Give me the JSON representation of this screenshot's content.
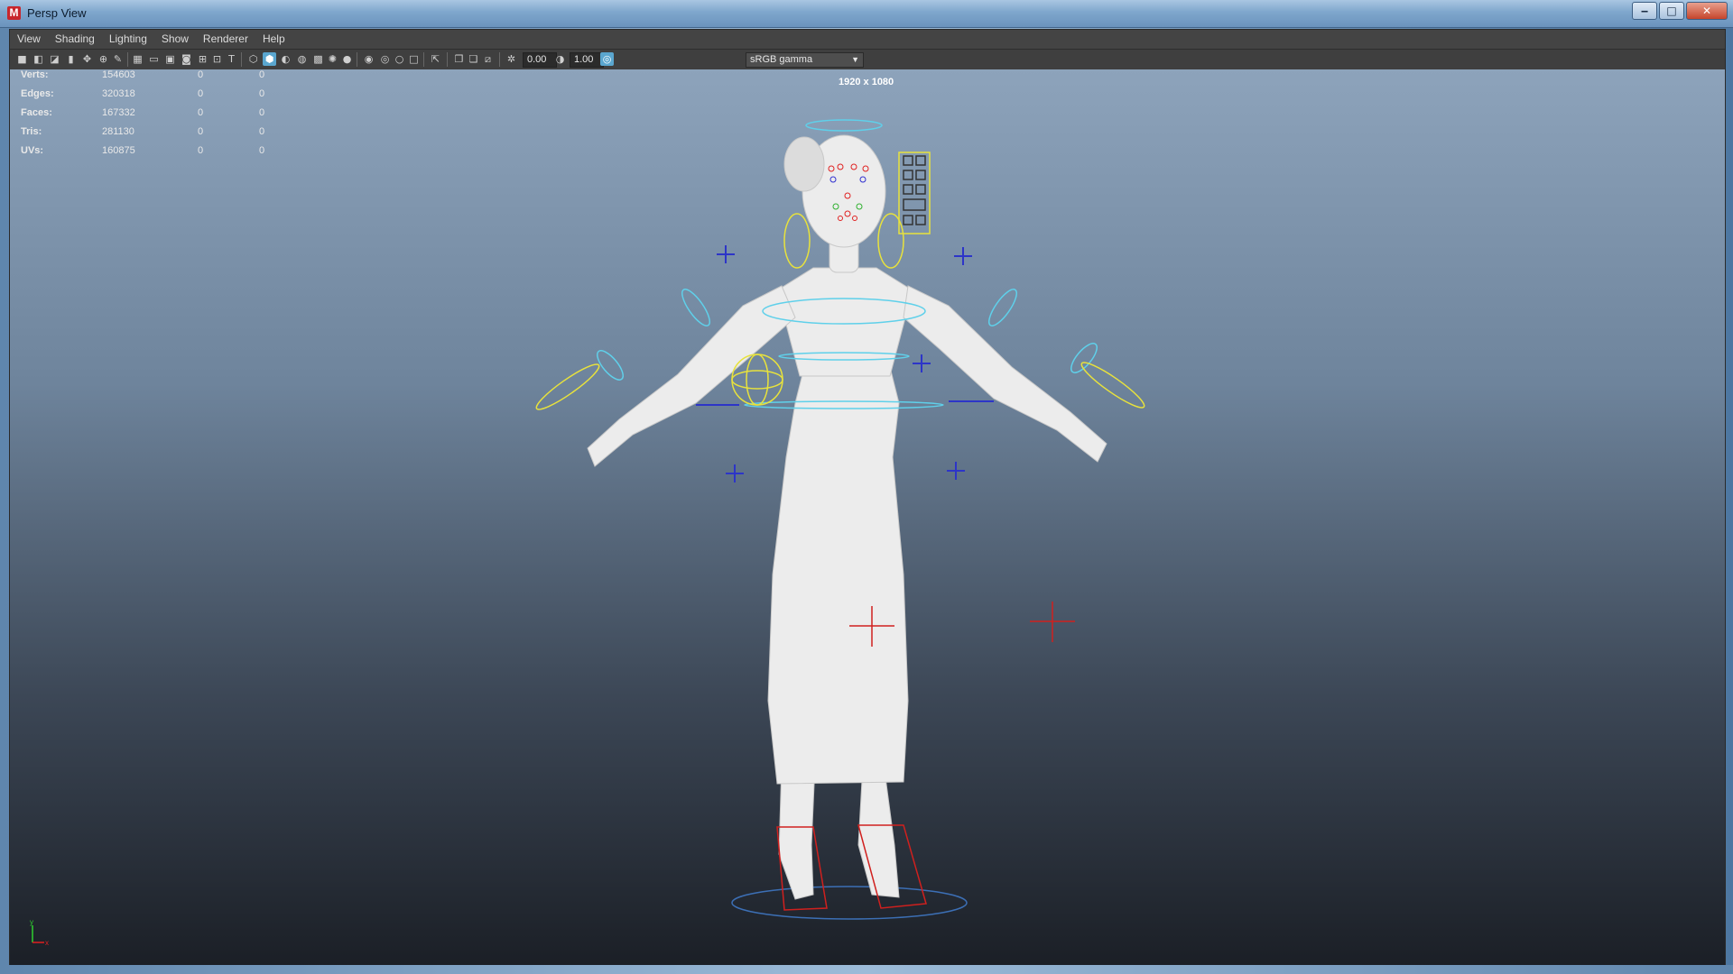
{
  "window": {
    "title": "Persp View",
    "app_icon": "M",
    "controls": {
      "minimize": "‒",
      "maximize": "□",
      "close": "✕"
    }
  },
  "menubar": {
    "items": [
      "View",
      "Shading",
      "Lighting",
      "Show",
      "Renderer",
      "Help"
    ]
  },
  "toolbar": {
    "exposure_value": "0.00",
    "gamma_value": "1.00",
    "color_space": "sRGB gamma",
    "icons": [
      "select-camera-icon",
      "camera-attributes-icon",
      "bookmark-icon",
      "image-plane-icon",
      "pan-icon",
      "grease-pencil-icon",
      "grid-icon",
      "film-gate-icon",
      "resolution-gate-icon",
      "gate-mask-icon",
      "field-chart-icon",
      "safe-action-icon",
      "safe-title-icon",
      "wireframe-icon",
      "smooth-shade-icon",
      "wireframe-on-shaded-icon",
      "textured-icon",
      "lights-icon",
      "shadows-icon",
      "screen-space-ao-icon",
      "motion-blur-icon",
      "anti-aliasing-icon",
      "depth-of-field-icon",
      "isolate-select-icon",
      "xray-icon",
      "xray-joints-icon",
      "xray-components-icon",
      "exposure-icon",
      "gamma-icon",
      "color-management-icon"
    ]
  },
  "hud": {
    "resolution": "1920 x 1080",
    "stats": [
      {
        "label": "Verts:",
        "total": "154603",
        "selected": "0",
        "components": "0"
      },
      {
        "label": "Edges:",
        "total": "320318",
        "selected": "0",
        "components": "0"
      },
      {
        "label": "Faces:",
        "total": "167332",
        "selected": "0",
        "components": "0"
      },
      {
        "label": "Tris:",
        "total": "281130",
        "selected": "0",
        "components": "0"
      },
      {
        "label": "UVs:",
        "total": "160875",
        "selected": "0",
        "components": "0"
      }
    ]
  },
  "axis": {
    "y": "y",
    "x": "x"
  },
  "colors": {
    "control_yellow": "#e8e23c",
    "control_cyan": "#5fd0ea",
    "control_blue": "#2d35c8",
    "control_red": "#d0201e",
    "mesh": "#eaeaea"
  }
}
